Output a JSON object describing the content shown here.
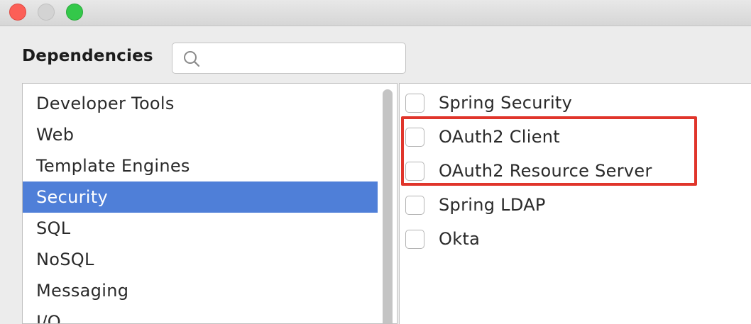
{
  "window": {
    "controls": [
      "close",
      "minimize",
      "zoom"
    ],
    "control_colors": {
      "close": "#fc5f57",
      "minimize": "#d3d3d3",
      "zoom": "#34c84a"
    }
  },
  "header": {
    "title": "Dependencies",
    "search": {
      "value": "",
      "placeholder": "",
      "icon": "search-icon"
    }
  },
  "categories": {
    "items": [
      {
        "label": "Developer Tools"
      },
      {
        "label": "Web"
      },
      {
        "label": "Template Engines"
      },
      {
        "label": "Security"
      },
      {
        "label": "SQL"
      },
      {
        "label": "NoSQL"
      },
      {
        "label": "Messaging"
      },
      {
        "label": "I/O"
      }
    ],
    "selected": "Security",
    "selection_color": "#4f7fd8"
  },
  "dependencies": {
    "items": [
      {
        "label": "Spring Security",
        "checked": false
      },
      {
        "label": "OAuth2 Client",
        "checked": false
      },
      {
        "label": "OAuth2 Resource Server",
        "checked": false
      },
      {
        "label": "Spring LDAP",
        "checked": false
      },
      {
        "label": "Okta",
        "checked": false
      }
    ]
  },
  "annotation": {
    "highlight_color": "#e0352b"
  }
}
